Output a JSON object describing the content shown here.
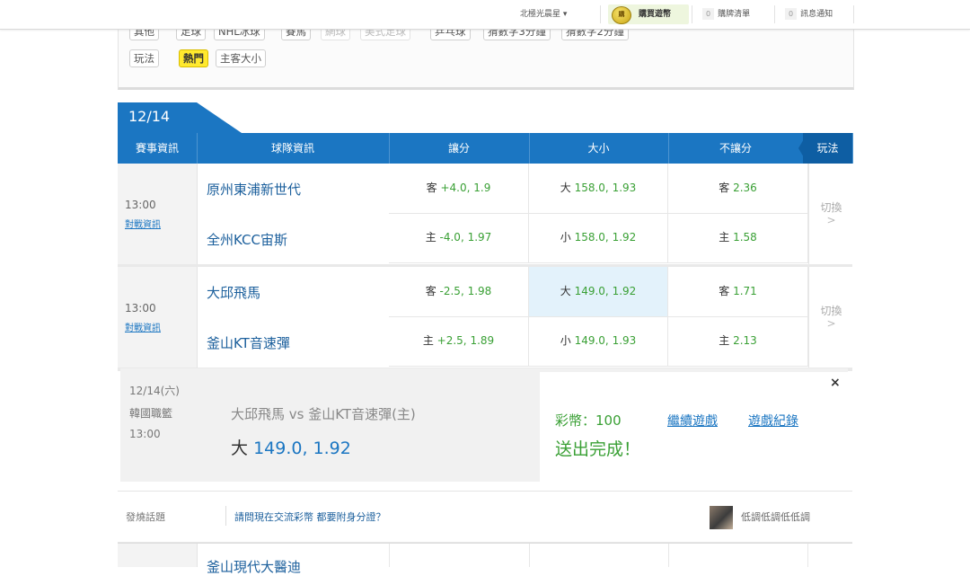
{
  "topbar": {
    "location": "北極光晨星 ▾",
    "buy_coin_badge": "購",
    "buy_coin": "購買遊幣",
    "cart_count": "0",
    "cart": "購牌清單",
    "notify_count": "0",
    "notify": "訊息通知"
  },
  "filter": {
    "row1": [
      "其他",
      "足球",
      "NHL冰球",
      "賽馬",
      "網球",
      "美式足球",
      "乒乓球",
      "猜數字3分鐘",
      "猜數字2分鐘"
    ],
    "row2_label": "玩法",
    "row2": [
      "熱門",
      "主客大小"
    ]
  },
  "date_tab": "12/14 (六)",
  "headers": {
    "info": "賽事資訊",
    "teams": "球隊資訊",
    "spread": "讓分",
    "total": "大小",
    "moneyline": "不讓分",
    "play": "玩法"
  },
  "matches": [
    {
      "time": "13:00",
      "link": "對戰資訊",
      "switch": "切換",
      "arrow": ">",
      "rows": [
        {
          "team": "原州東浦新世代",
          "spread_label": "客",
          "spread_line": "+4.0,",
          "spread_odds": "1.9",
          "total_label": "大",
          "total_line": "158.0,",
          "total_odds": "1.93",
          "ml_label": "客",
          "ml_odds": "2.36"
        },
        {
          "team": "全州KCC宙斯",
          "spread_label": "主",
          "spread_line": "-4.0,",
          "spread_odds": "1.97",
          "total_label": "小",
          "total_line": "158.0,",
          "total_odds": "1.92",
          "ml_label": "主",
          "ml_odds": "1.58"
        }
      ]
    },
    {
      "time": "13:00",
      "link": "對戰資訊",
      "switch": "切換",
      "arrow": ">",
      "rows": [
        {
          "team": "大邱飛馬",
          "spread_label": "客",
          "spread_line": "-2.5,",
          "spread_odds": "1.98",
          "total_label": "大",
          "total_line": "149.0,",
          "total_odds": "1.92",
          "ml_label": "客",
          "ml_odds": "1.71"
        },
        {
          "team": "釜山KT音速彈",
          "spread_label": "主",
          "spread_line": "+2.5,",
          "spread_odds": "1.89",
          "total_label": "小",
          "total_line": "149.0,",
          "total_odds": "1.93",
          "ml_label": "主",
          "ml_odds": "2.13"
        }
      ]
    }
  ],
  "confirm": {
    "date": "12/14(六)",
    "league": "韓國職籃",
    "time": "13:00",
    "matchup": "大邱飛馬  vs  釜山KT音速彈(主)",
    "pick_label": "大",
    "pick_value": "149.0, 1.92",
    "coins": "彩幣：100",
    "continue": "繼續遊戲",
    "history": "遊戲紀錄",
    "done": "送出完成！",
    "close": "×"
  },
  "topic": {
    "label": "發燒話題",
    "text": "請問現在交流彩幣 都要附身分證？",
    "user": "低調低調低低調"
  },
  "next_team": "釜山現代大醫迪"
}
